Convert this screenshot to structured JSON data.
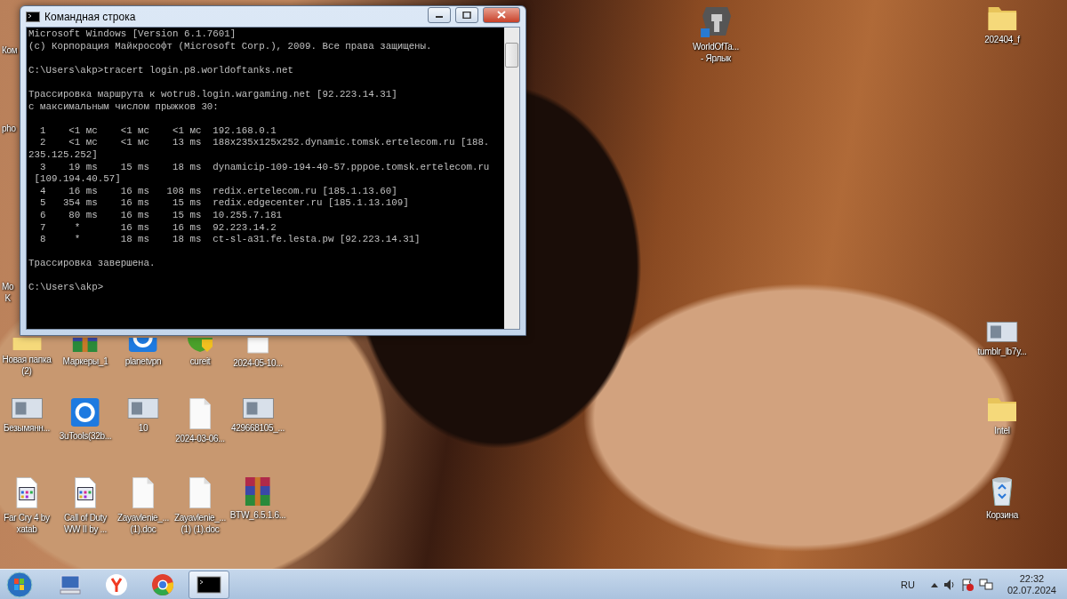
{
  "window": {
    "title": "Командная строка",
    "controls": [
      {
        "kind": "minimize"
      },
      {
        "kind": "maximize"
      },
      {
        "kind": "close"
      }
    ]
  },
  "console": {
    "blocks": [
      [
        "Microsoft Windows [Version 6.1.7601]",
        "(c) Корпорация Майкрософт (Microsoft Corp.), 2009. Все права защищены."
      ],
      [
        "C:\\Users\\akp>tracert login.p8.worldoftanks.net"
      ],
      [
        "Трассировка маршрута к wotru8.login.wargaming.net [92.223.14.31]",
        "с максимальным числом прыжков 30:"
      ],
      [
        "  1    <1 мс    <1 мс    <1 мс  192.168.0.1",
        "  2    <1 мс    <1 мс    13 ms  188x235x125x252.dynamic.tomsk.ertelecom.ru [188.",
        "235.125.252]",
        "  3    19 ms    15 ms    18 ms  dynamicip-109-194-40-57.pppoe.tomsk.ertelecom.ru",
        " [109.194.40.57]",
        "  4    16 ms    16 ms   108 ms  redix.ertelecom.ru [185.1.13.60]",
        "  5   354 ms    16 ms    15 ms  redix.edgecenter.ru [185.1.13.109]",
        "  6    80 ms    16 ms    15 ms  10.255.7.181",
        "  7     *       16 ms    16 ms  92.223.14.2",
        "  8     *       18 ms    18 ms  ct-sl-a31.fe.lesta.pw [92.223.14.31]"
      ],
      [
        "Трассировка завершена."
      ],
      [
        "C:\\Users\\akp>"
      ]
    ]
  },
  "desktop_icons": [
    {
      "kind": "covered",
      "label": [
        "Ком"
      ]
    },
    {
      "kind": "game",
      "label": [
        "WorldOfTa...",
        "- Ярлык"
      ]
    },
    {
      "kind": "folder",
      "label": [
        "202404_f"
      ]
    },
    {
      "kind": "covered",
      "label": [
        "pho"
      ]
    },
    {
      "kind": "covered",
      "label": [
        "Mo",
        "K"
      ]
    },
    {
      "kind": "folder",
      "label": [
        "Новая папка",
        "(2)"
      ]
    },
    {
      "kind": "archive",
      "label": [
        "Маркеры_1"
      ]
    },
    {
      "kind": "app",
      "label": [
        "planetvpn"
      ]
    },
    {
      "kind": "shield",
      "label": [
        "cureit"
      ]
    },
    {
      "kind": "document",
      "label": [
        "2024-05-10..."
      ]
    },
    {
      "kind": "image",
      "label": [
        "Безымянн..."
      ]
    },
    {
      "kind": "app",
      "label": [
        "3uTools(32b..."
      ]
    },
    {
      "kind": "image",
      "label": [
        "10"
      ]
    },
    {
      "kind": "document",
      "label": [
        "2024-03-06..."
      ]
    },
    {
      "kind": "image",
      "label": [
        "429668105_..."
      ]
    },
    {
      "kind": "program",
      "label": [
        "Far Cry 4 by",
        "xatab"
      ]
    },
    {
      "kind": "program",
      "label": [
        "Call of Duty",
        "WW II by ..."
      ]
    },
    {
      "kind": "document",
      "label": [
        "Zayavlenie_...",
        "(1).doc"
      ]
    },
    {
      "kind": "document",
      "label": [
        "Zayavlenie_...",
        "(1) (1).doc"
      ]
    },
    {
      "kind": "archive",
      "label": [
        "BTW_6.5.1.6..."
      ]
    },
    {
      "kind": "image",
      "label": [
        "tumblr_lb7y..."
      ]
    },
    {
      "kind": "folder",
      "label": [
        "Intel"
      ]
    },
    {
      "kind": "trash",
      "label": [
        "Корзина"
      ]
    }
  ],
  "taskbar": {
    "items": [
      {
        "kind": "computer",
        "selected": false
      },
      {
        "kind": "yandex",
        "selected": false
      },
      {
        "kind": "chrome",
        "selected": false
      },
      {
        "kind": "console",
        "selected": true
      }
    ],
    "language": "RU",
    "time": "22:32",
    "date": "02.07.2024"
  }
}
